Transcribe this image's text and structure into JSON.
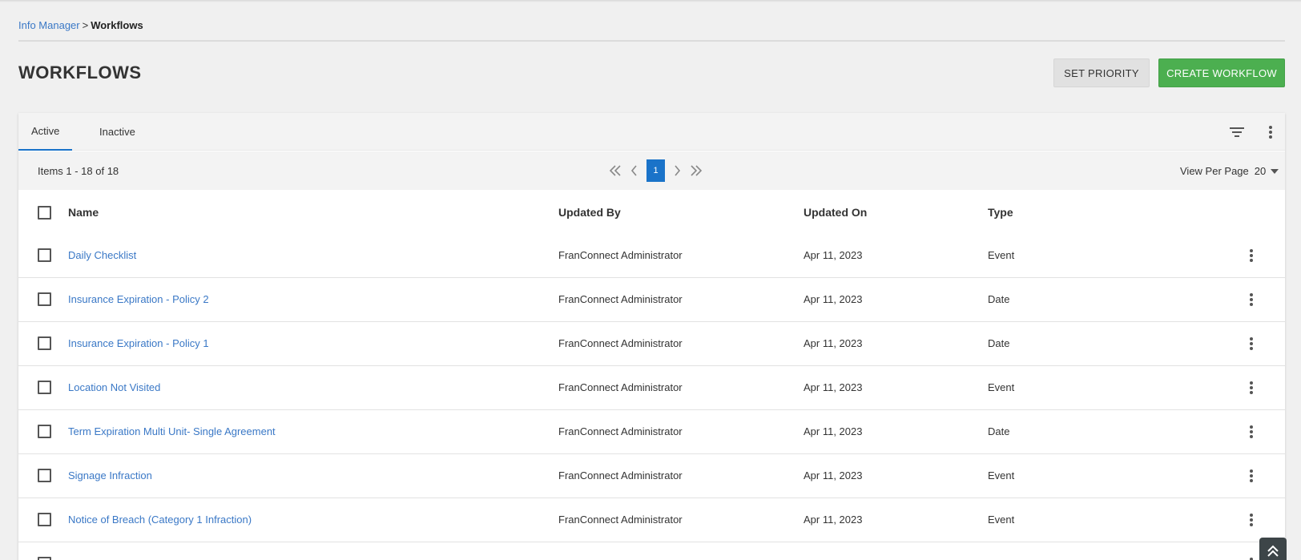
{
  "breadcrumb": {
    "parent": "Info Manager",
    "separator": ">",
    "current": "Workflows"
  },
  "page": {
    "title": "WORKFLOWS"
  },
  "actions": {
    "set_priority": "SET PRIORITY",
    "create_workflow": "CREATE WORKFLOW"
  },
  "tabs": [
    {
      "label": "Active",
      "selected": true
    },
    {
      "label": "Inactive",
      "selected": false
    }
  ],
  "pagination": {
    "items_label": "Items 1 - 18 of 18",
    "current_page": "1",
    "view_per_page_label": "View Per Page",
    "view_per_page_value": "20"
  },
  "table": {
    "columns": {
      "name": "Name",
      "updated_by": "Updated By",
      "updated_on": "Updated On",
      "type": "Type"
    },
    "rows": [
      {
        "name": "Daily Checklist",
        "updated_by": "FranConnect Administrator",
        "updated_on": "Apr 11, 2023",
        "type": "Event"
      },
      {
        "name": "Insurance Expiration - Policy 2",
        "updated_by": "FranConnect Administrator",
        "updated_on": "Apr 11, 2023",
        "type": "Date"
      },
      {
        "name": "Insurance Expiration - Policy 1",
        "updated_by": "FranConnect Administrator",
        "updated_on": "Apr 11, 2023",
        "type": "Date"
      },
      {
        "name": "Location Not Visited",
        "updated_by": "FranConnect Administrator",
        "updated_on": "Apr 11, 2023",
        "type": "Event"
      },
      {
        "name": "Term Expiration Multi Unit- Single Agreement",
        "updated_by": "FranConnect Administrator",
        "updated_on": "Apr 11, 2023",
        "type": "Date"
      },
      {
        "name": "Signage Infraction",
        "updated_by": "FranConnect Administrator",
        "updated_on": "Apr 11, 2023",
        "type": "Event"
      },
      {
        "name": "Notice of Breach (Category 1 Infraction)",
        "updated_by": "FranConnect Administrator",
        "updated_on": "Apr 11, 2023",
        "type": "Event"
      },
      {
        "name": "",
        "updated_by": "",
        "updated_on": "",
        "type": ""
      }
    ]
  },
  "colors": {
    "accent": "#1a73c9",
    "link": "#3a78c6",
    "create_button": "#4caf50"
  },
  "icons": {
    "filter": "filter-icon",
    "more": "more-vertical-icon",
    "first": "double-chevron-left-icon",
    "prev": "chevron-left-icon",
    "next": "chevron-right-icon",
    "last": "double-chevron-right-icon",
    "scroll_top": "double-chevron-up-icon"
  }
}
